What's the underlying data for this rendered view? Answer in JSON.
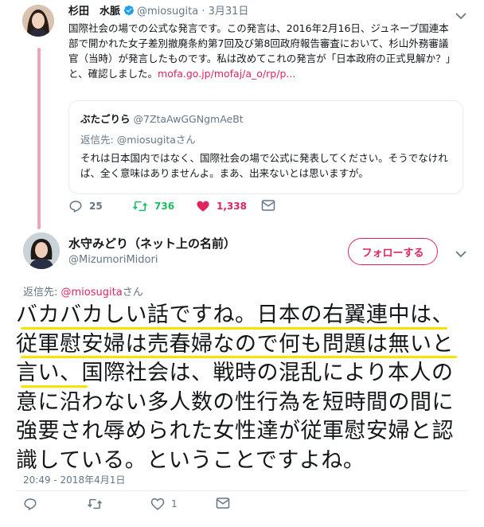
{
  "parent_tweet": {
    "author_name": "杉田　水脈",
    "handle": "@miosugita",
    "dot": "·",
    "date": "3月31日",
    "text": "国際社会の場での公式な発言です。この発言は、2016年2月16日、ジュネーブ国連本部で開かれた女子差別撤廃条約第7回及び第8回政府報告審査において、杉山外務審議官（当時）が発言したものです。私は改めてこれの発言が「日本政府の正式見解か？」と、確認しました。",
    "link": "mofa.go.jp/mofaj/a_o/rp/p...",
    "quote": {
      "author_name": "ぶたごりら",
      "handle": "@7ZtaAwGGNgmAeBt",
      "reply_label": "返信先: ",
      "reply_to": "@miosugita",
      "reply_suffix": "さん",
      "text": "それは日本国内ではなく、国際社会の場で公式に発表してください。そうでなければ、全く意味はありませんよ。まあ、出来ないとは思いますが。"
    },
    "actions": {
      "reply_count": "25",
      "retweet_count": "736",
      "like_count": "1,338"
    }
  },
  "main_tweet": {
    "author_name": "水守みどり（ネット上の名前）",
    "handle": "@MizumoriMidori",
    "follow_label": "フォローする",
    "reply_label": "返信先: ",
    "reply_to": "@miosugita",
    "reply_suffix": "さん",
    "text_lines": [
      "バカバカしい話ですね。日本の右翼連中は、",
      "従軍慰安婦は売春婦なので何も問題は無いと",
      "言い、国際社会は、戦時の混乱により本人の",
      "意に沿わない多人数の性行為を短時間の間に",
      "強要され辱められた女性達が従軍慰安婦と認",
      "識している。ということですよね。"
    ],
    "timestamp": "20:49 - 2018年4月1日",
    "actions": {
      "reply_count": "",
      "retweet_count": "",
      "like_count": "1"
    }
  },
  "colors": {
    "accent": "#e0245e",
    "retweet": "#17bf63",
    "verified": "#1da1f2",
    "highlight": "#f7e200",
    "muted": "#657786",
    "thread_line": "#f4a2b6"
  },
  "icons": [
    "verified-badge-icon",
    "chevron-down-icon",
    "reply-icon",
    "retweet-icon",
    "like-icon",
    "dm-icon"
  ]
}
